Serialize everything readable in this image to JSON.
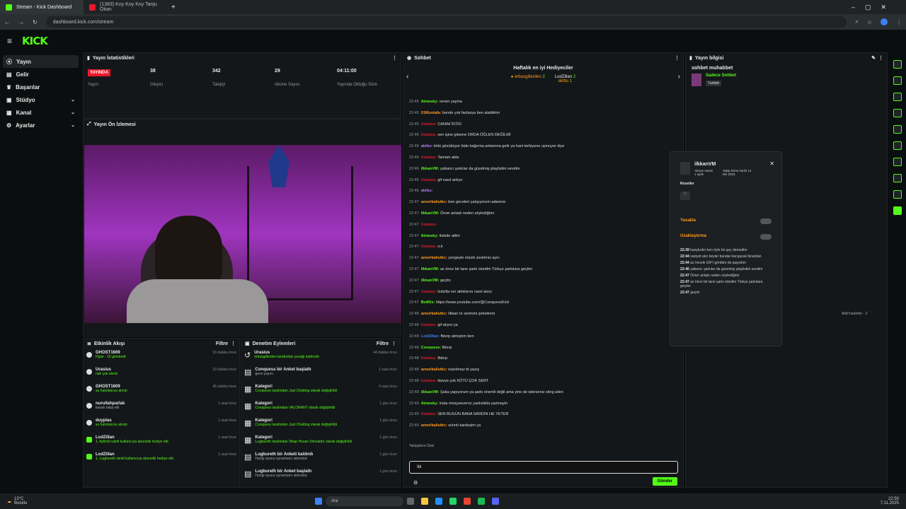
{
  "browser": {
    "tabs": [
      {
        "label": "Stream - Kick Dashboard",
        "color": "#53fc18"
      },
      {
        "label": "(1383) Koy Koy Koy Tanju Okan",
        "color": "#e8192c"
      }
    ],
    "url": "dashboard.kick.com/stream"
  },
  "logo": "KICK",
  "nav": [
    {
      "label": "Yayın",
      "active": true
    },
    {
      "label": "Gelir"
    },
    {
      "label": "Başarılar"
    },
    {
      "label": "Stüdyo",
      "chev": true
    },
    {
      "label": "Kanal",
      "chev": true
    },
    {
      "label": "Ayarlar",
      "chev": true
    }
  ],
  "stats": {
    "title": "Yayın İstatistikleri",
    "live_badge": "YAYINDA",
    "items": [
      {
        "value": "",
        "label": "Yayın"
      },
      {
        "value": "38",
        "label": "İzleyici"
      },
      {
        "value": "342",
        "label": "Takipçi"
      },
      {
        "value": "29",
        "label": "Abone Sayısı"
      },
      {
        "value": "04:11:00",
        "label": "Yayında Olduğu Süre"
      }
    ]
  },
  "preview": {
    "title": "Yayın Ön İzlemesi"
  },
  "activity": {
    "title": "Etkinlik Akışı",
    "filter": "Filtre",
    "items": [
      {
        "name": "GHOST1609",
        "desc": "Hype · 10 gönderdi",
        "time": "16 dakika önce"
      },
      {
        "name": "Urasius",
        "desc": "nah çek alındı",
        "time": "19 dakika önce"
      },
      {
        "name": "GHOST1609",
        "desc": "su hatırlatıcısı alındı",
        "time": "45 dakika önce"
      },
      {
        "name": "nurullahparlak",
        "desc": "kanalı takip etti",
        "time": "1 saat önce"
      },
      {
        "name": "duyplas",
        "desc": "su hatırlatıcısı alındı",
        "time": "1 saat önce"
      },
      {
        "name": "LodZillan",
        "desc": "1, AylinSt isimli kullanıcıya abonelik hediye etti.",
        "time": "1 saat önce"
      },
      {
        "name": "LodZillan",
        "desc": "1, Lugbureth isimli kullanıcıya abonelik hediye etti.",
        "time": "1 saat önce"
      }
    ]
  },
  "mod": {
    "title": "Denetim Eylemleri",
    "filter": "Filtre",
    "items": [
      {
        "name": "Urasius",
        "desc": "erbasgillerden tarafından yasağı kaldırıldı",
        "time": "44 dakika önce"
      },
      {
        "name": "Conquess bir Anket başlattı",
        "desc": "gece yayını",
        "time": "1 saat önce"
      },
      {
        "name": "Kategori",
        "desc": "Conquess tarafından Just Chatting olarak değiştirildi",
        "time": "4 saat önce"
      },
      {
        "name": "Kategori",
        "desc": "Conquess tarafından VALORANT olarak değiştirildi",
        "time": "1 gün önce"
      },
      {
        "name": "Kategori",
        "desc": "Conquess tarafından Just Chatting olarak değiştirildi",
        "time": "1 gün önce"
      },
      {
        "name": "Kategori",
        "desc": "Lugbureth tarafından Wrap House Simulator olarak değiştirildi",
        "time": "1 gün önce"
      },
      {
        "name": "Lugbureth bir Anketi kaldırdı",
        "desc": "Hangi oyunu oynamamı istersiniz",
        "time": "1 gün önce"
      },
      {
        "name": "Lugbureth bir Anket başlattı",
        "desc": "Hangi oyunu oynamamı istersiniz",
        "time": "1 gün önce"
      }
    ]
  },
  "chat": {
    "title": "Sohbet",
    "gift_title": "Haftalık en iyi Hediyeciler",
    "gifters": [
      {
        "name": "erbasgillerden",
        "n": "2"
      },
      {
        "name": "LodZillan",
        "n": "2"
      },
      {
        "name": "aktbu",
        "n": "1"
      }
    ],
    "messages": [
      {
        "t": "22:45",
        "u": "Atowsky",
        "c": "#53fc18",
        "m": "versin yayina"
      },
      {
        "t": "22:45",
        "u": "01Mustafa",
        "c": "#ff9a1f",
        "m": "bende yok fazlasya ben alabilirim"
      },
      {
        "t": "22:45",
        "u": "Urasius",
        "c": "#e8192c",
        "m": "CANIM İSTİO"
      },
      {
        "t": "22:46",
        "u": "Urasius",
        "c": "#e8192c",
        "m": "sen işine gitsene ORDA ÖĞLEN DEĞİLMİ"
      },
      {
        "t": "22:46",
        "u": "aktbu",
        "c": "#b07cff",
        "m": "kötü gözüküyor bide bağırma anlamına gelir ya hani terbiyene uymuyor diye"
      },
      {
        "t": "22:46",
        "u": "Urasius",
        "c": "#e8192c",
        "m": "Tamam abla"
      },
      {
        "t": "22:46",
        "u": "ilkkanVM",
        "c": "#53fc18",
        "m": "yabancı şarkılar da güzelmiş playlistini sevdim"
      },
      {
        "t": "22:46",
        "u": "Urasius",
        "c": "#e8192c",
        "m": "gif nasıl atılıyo"
      },
      {
        "t": "22:46",
        "u": "aktbu",
        "c": "#b07cff",
        "m": ""
      },
      {
        "t": "22:47",
        "u": "amerikaliutkc",
        "c": "#ff9a1f",
        "m": "ben geceleri çalışıyorum adamım"
      },
      {
        "t": "22:47",
        "u": "ilkkanVM",
        "c": "#53fc18",
        "m": "Ömer anladı neden söylediğimi"
      },
      {
        "t": "22:47",
        "u": "Urasius",
        "c": "#e8192c",
        "m": ""
      },
      {
        "t": "22:47",
        "u": "Atowsky",
        "c": "#53fc18",
        "m": "linkide attim"
      },
      {
        "t": "22:47",
        "u": "Urasius",
        "c": "#e8192c",
        "m": "o.k"
      },
      {
        "t": "22:47",
        "u": "amerikaliutkc",
        "c": "#ff9a1f",
        "m": "yengeyle müzik zevkimiz aynı"
      },
      {
        "t": "22:47",
        "u": "ilkkanVM",
        "c": "#53fc18",
        "m": "az önce bir tane şarkı istedim Türkçe şarkılara geçtim"
      },
      {
        "t": "22:47",
        "u": "ilkkanVM",
        "c": "#53fc18",
        "m": "geçtin"
      },
      {
        "t": "22:47",
        "u": "Urasius",
        "c": "#e8192c",
        "m": "lodzilla nın attıklarını nasıl atıoz"
      },
      {
        "t": "22:47",
        "u": "BotRix",
        "c": "#53fc18",
        "m": "https://www.youtube.com/@ConquessKick"
      },
      {
        "t": "22:48",
        "u": "amerikaliutkc",
        "c": "#ff9a1f",
        "m": "ilkkan tır senlnmi şirketinmi"
      },
      {
        "t": "22:48",
        "u": "Urasius",
        "c": "#e8192c",
        "m": "gif atıyor ya"
      },
      {
        "t": "22:48",
        "u": "LodZillan",
        "c": "#3b82f6",
        "m": "fblerp atmıştım ben"
      },
      {
        "t": "22:48",
        "u": "Conquess",
        "c": "#53fc18",
        "m": "fblerp"
      },
      {
        "t": "22:48",
        "u": "Urasius",
        "c": "#e8192c",
        "m": "fblerp"
      },
      {
        "t": "22:48",
        "u": "amerikaliutkc",
        "c": "#ff9a1f",
        "m": "inanılmaz bi yazış"
      },
      {
        "t": "22:48",
        "u": "Urasius",
        "c": "#e8192c",
        "m": "klavye çok KÖTÜ ÇOK SERT"
      },
      {
        "t": "22:48",
        "u": "ilkkanVM",
        "c": "#53fc18",
        "m": "Şaka yapıyorum ya şarkı önemli değil ama yine de isterseniz sting alien"
      },
      {
        "t": "22:49",
        "u": "Atowsky",
        "c": "#53fc18",
        "m": "insta miraysevernz yanlıslıkla yazmayin"
      },
      {
        "t": "22:49",
        "u": "Urasius",
        "c": "#e8192c",
        "m": "SEN BUGÜN BANA SARDIN HE YETER"
      },
      {
        "t": "22:49",
        "u": "amerikaliutkc",
        "c": "#ff9a1f",
        "m": "sıkıntı kardeşim ya"
      }
    ],
    "followers_only": "Takipçilere Özel",
    "input_value": "Ibi",
    "send_label": "Gönder"
  },
  "info": {
    "title": "Yayın bilgisi",
    "stream_title": "sohbet muhabbet",
    "category": "Sadece Sohbet",
    "lang": "Turkish",
    "side_label": "Aktif hedefler - 2"
  },
  "popup": {
    "user": "ilkkanVM",
    "sub": "Abone süresi 1 aylık",
    "follow": "Takip Etme Tarihi 13 Eki 2025",
    "badges_label": "Rozetler",
    "ban": "Yasakla",
    "timeout": "Uzaklaştırma",
    "history": [
      {
        "t": "22:39",
        "m": "kanştırdın ben öyle bir şey demedim"
      },
      {
        "t": "22:44",
        "m": "vaziyet alın beyler buralar karışacak birazdan"
      },
      {
        "t": "22:44",
        "m": "az önceki GIF'i gördüm de şaşırdım"
      },
      {
        "t": "22:46",
        "m": "yabancı şarkılar da güzelmiş playlistini sevdim"
      },
      {
        "t": "22:47",
        "m": "Ömer anladı neden söylediğimi"
      },
      {
        "t": "22:47",
        "m": "az önce bir tane şarkı istedim Türkçe şarkılara geçtim"
      },
      {
        "t": "22:47",
        "m": "geçtin"
      }
    ]
  },
  "taskbar": {
    "weather_temp": "13°C",
    "weather_desc": "Bulutlu",
    "search": "Ara",
    "time": "22:50",
    "date": "7.11.2025"
  }
}
